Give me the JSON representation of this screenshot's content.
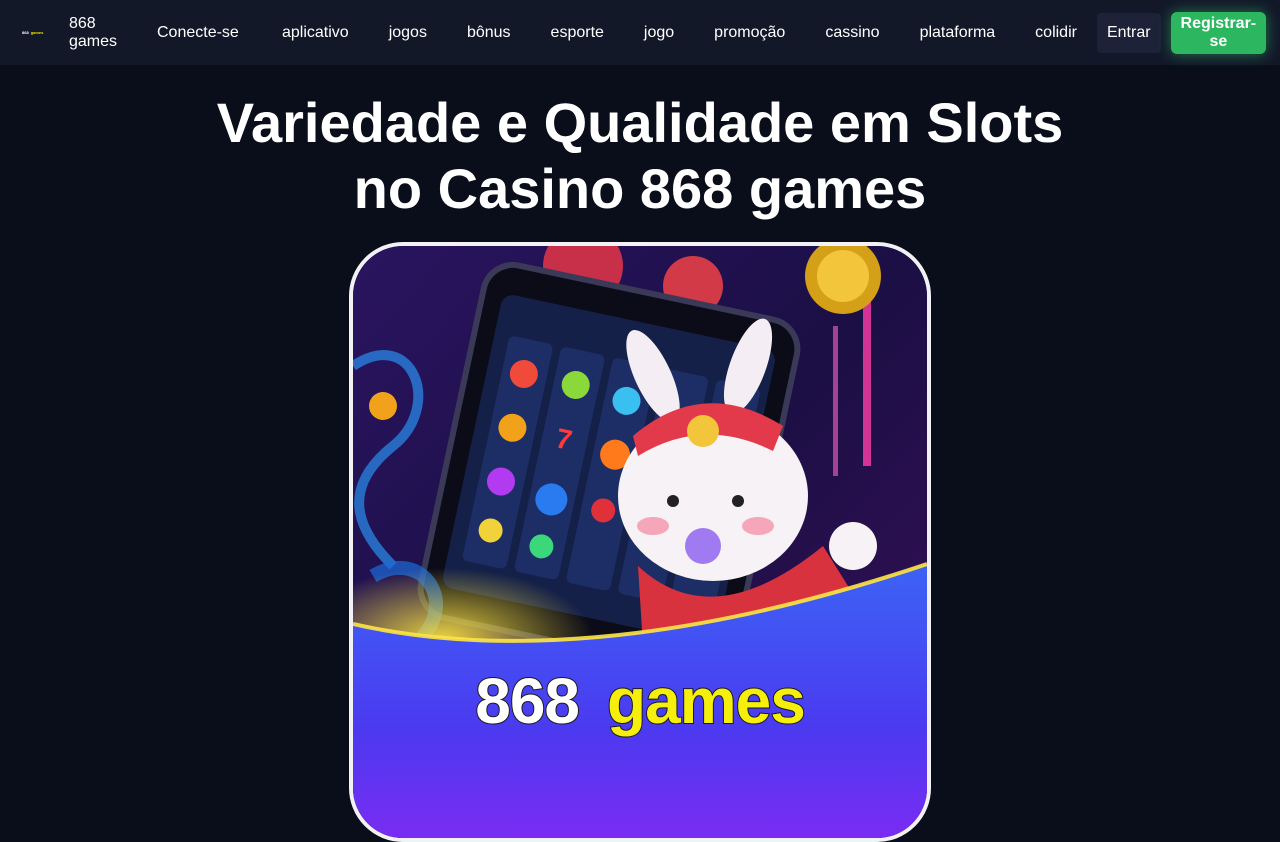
{
  "brand": {
    "logo_text_a": "868",
    "logo_text_b": "games",
    "name": "868 games"
  },
  "nav": {
    "links": [
      {
        "label": "Conecte-se"
      },
      {
        "label": "aplicativo"
      },
      {
        "label": "jogos"
      },
      {
        "label": "bônus"
      },
      {
        "label": "esporte"
      },
      {
        "label": "jogo"
      },
      {
        "label": "promoção"
      },
      {
        "label": "cassino"
      },
      {
        "label": "plataforma"
      },
      {
        "label": "colidir"
      }
    ],
    "login_label": "Entrar",
    "register_label": "Registrar-se"
  },
  "hero": {
    "title_line1": "Variedade e Qualidade em Slots",
    "title_line2": "no Casino 868 games",
    "image_logo_num": "868",
    "image_logo_word": "games"
  },
  "colors": {
    "page_bg": "#0a0e1a",
    "navbar_bg": "#131829",
    "register_green": "#2bb65f",
    "logo_yellow": "#f6ee0b",
    "banner_blue": "#3b55f0"
  }
}
